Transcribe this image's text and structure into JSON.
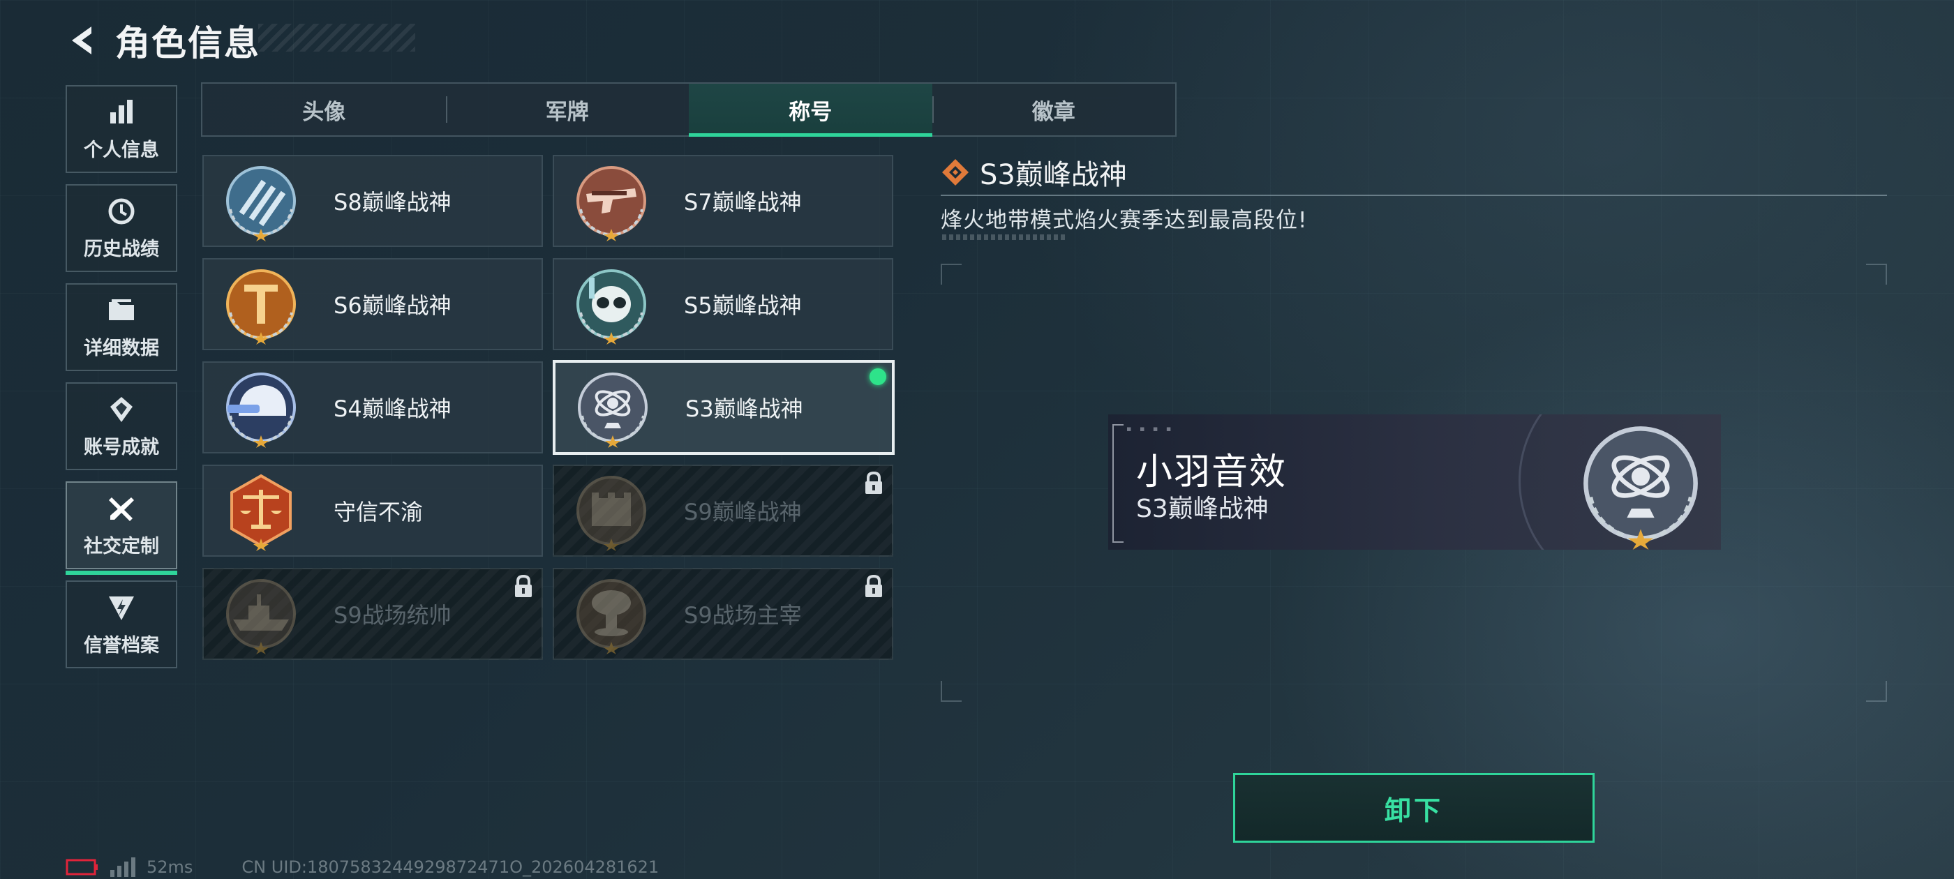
{
  "header": {
    "title": "角色信息"
  },
  "sidebar": {
    "items": [
      {
        "label": "个人信息",
        "icon": "bar-chart-icon"
      },
      {
        "label": "历史战绩",
        "icon": "history-icon"
      },
      {
        "label": "详细数据",
        "icon": "folder-icon"
      },
      {
        "label": "账号成就",
        "icon": "achievement-icon"
      },
      {
        "label": "社交定制",
        "icon": "tools-icon",
        "active": true
      },
      {
        "label": "信誉档案",
        "icon": "shield-bolt-icon"
      }
    ]
  },
  "tabs": [
    {
      "label": "头像"
    },
    {
      "label": "军牌"
    },
    {
      "label": "称号",
      "active": true
    },
    {
      "label": "徽章"
    }
  ],
  "titles": [
    {
      "label": "S8巅峰战神",
      "emblem": "blue-stripes-emblem",
      "locked": false
    },
    {
      "label": "S7巅峰战神",
      "emblem": "rifle-emblem",
      "locked": false
    },
    {
      "label": "S6巅峰战神",
      "emblem": "orange-shield-emblem",
      "locked": false
    },
    {
      "label": "S5巅峰战神",
      "emblem": "diver-skull-emblem",
      "locked": false
    },
    {
      "label": "S4巅峰战神",
      "emblem": "helmet-emblem",
      "locked": false
    },
    {
      "label": "S3巅峰战神",
      "emblem": "armillary-emblem",
      "locked": false,
      "selected": true,
      "equipped": true
    },
    {
      "label": "守信不渝",
      "emblem": "scales-emblem",
      "locked": false
    },
    {
      "label": "S9巅峰战神",
      "emblem": "fortress-emblem",
      "locked": true
    },
    {
      "label": "S9战场统帅",
      "emblem": "warship-emblem",
      "locked": true
    },
    {
      "label": "S9战场主宰",
      "emblem": "mushroom-cloud-emblem",
      "locked": true
    }
  ],
  "detail": {
    "title": "S3巅峰战神",
    "description": "烽火地带模式焰火赛季达到最高段位!"
  },
  "nameplate": {
    "name": "小羽音效",
    "title": "S3巅峰战神"
  },
  "action": {
    "label": "卸下"
  },
  "status": {
    "ping": "52ms",
    "uid": "CN UID:1807583244929872471O_202604281621"
  },
  "colors": {
    "accent": "#2fd49a",
    "equipped_dot": "#2ee38a",
    "diamond": "#e07a3a"
  }
}
